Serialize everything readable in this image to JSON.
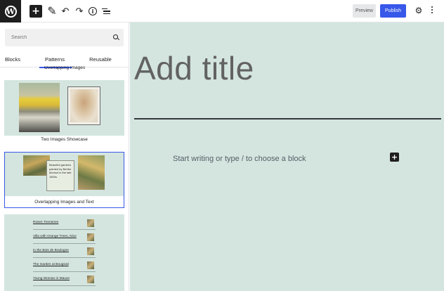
{
  "toolbar": {
    "logo_glyph": "W",
    "add_glyph": "+",
    "pen_glyph": "✎",
    "undo_glyph": "↶",
    "redo_glyph": "↷",
    "info_glyph": "i",
    "preview_label": "Preview",
    "publish_label": "Publish",
    "gear_glyph": "⚙"
  },
  "sidebar": {
    "search_placeholder": "Search",
    "tabs": [
      {
        "label": "Blocks"
      },
      {
        "label": "Patterns",
        "active": true
      },
      {
        "label": "Reusable"
      }
    ],
    "cut_label": "Overlapping Images",
    "patterns": [
      {
        "label": "Two Images Showcase"
      },
      {
        "label": "Overlapping Images and Text",
        "selected": true,
        "card_text": "Beautiful gardens painted by Berthe Morisot in the late 1800s."
      }
    ],
    "list_items": [
      "Roses Tremieres",
      "Villa with Orange Trees, Nice",
      "In the Bois de Boulogne",
      "The Garden at Bougival",
      "Young Woman in Mauve"
    ]
  },
  "editor": {
    "title_placeholder": "Add title",
    "block_placeholder": "Start writing or type / to choose a block",
    "inline_add_glyph": "+"
  },
  "colors": {
    "canvas_bg": "#d4e5df",
    "accent": "#3858e9",
    "dark": "#1e1e1e"
  }
}
